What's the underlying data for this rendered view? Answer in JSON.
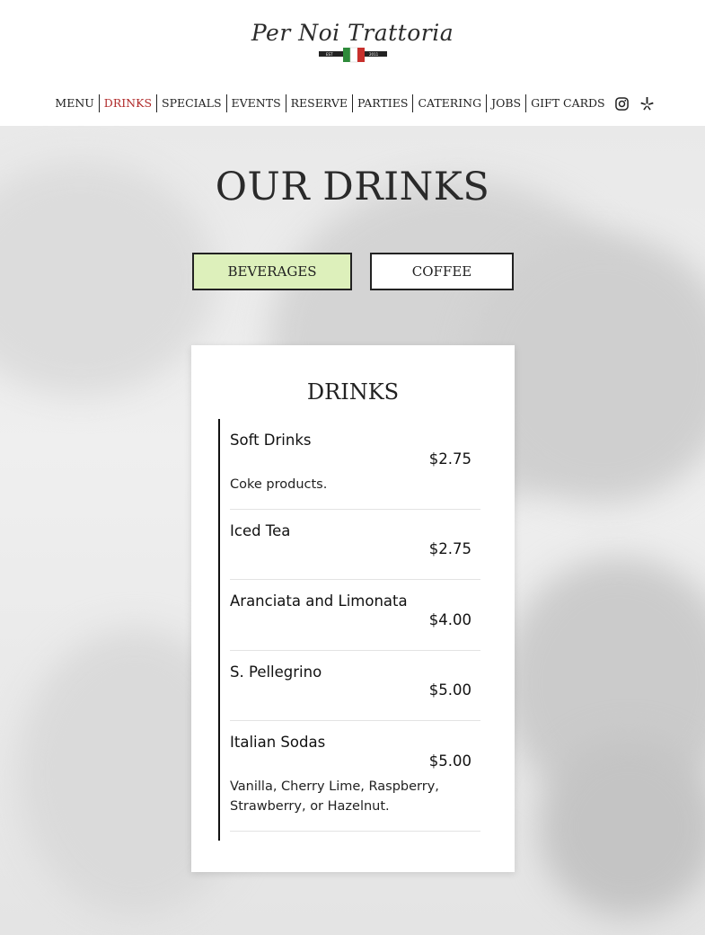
{
  "logo": {
    "text": "Per Noi Trattoria",
    "flag_left": "EST",
    "flag_right": "2011"
  },
  "nav": {
    "items": [
      {
        "label": "MENU"
      },
      {
        "label": "DRINKS"
      },
      {
        "label": "SPECIALS"
      },
      {
        "label": "EVENTS"
      },
      {
        "label": "RESERVE"
      },
      {
        "label": "PARTIES"
      },
      {
        "label": "CATERING"
      },
      {
        "label": "JOBS"
      },
      {
        "label": "GIFT CARDS"
      }
    ],
    "active": "DRINKS",
    "icons": [
      "instagram-icon",
      "yelp-icon"
    ]
  },
  "page": {
    "title": "OUR DRINKS"
  },
  "tabs": [
    {
      "label": "BEVERAGES",
      "selected": true
    },
    {
      "label": "COFFEE",
      "selected": false
    }
  ],
  "menu": {
    "section_title": "DRINKS",
    "items": [
      {
        "name": "Soft Drinks",
        "price": "$2.75",
        "description": "Coke products."
      },
      {
        "name": "Iced Tea",
        "price": "$2.75",
        "description": ""
      },
      {
        "name": "Aranciata and Limonata",
        "price": "$4.00",
        "description": ""
      },
      {
        "name": "S. Pellegrino",
        "price": "$5.00",
        "description": ""
      },
      {
        "name": "Italian Sodas",
        "price": "$5.00",
        "description": "Vanilla, Cherry Lime, Raspberry, Strawberry, or Hazelnut."
      }
    ]
  },
  "colors": {
    "active_nav": "#b02a2a",
    "selected_tab": "#ddf0bb",
    "flag_green": "#2e8b3a",
    "flag_red": "#c8302c"
  }
}
